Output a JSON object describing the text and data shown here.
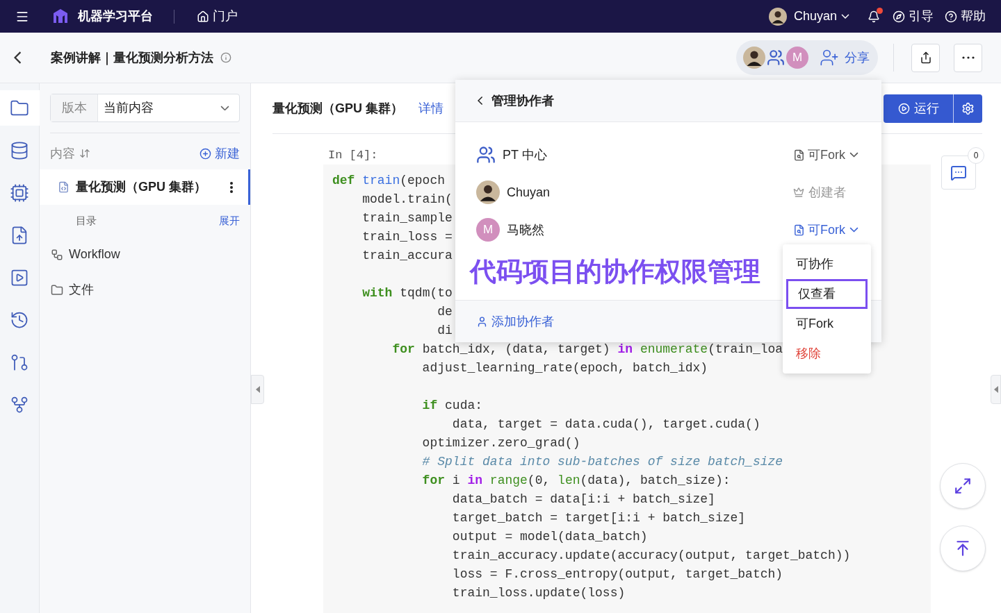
{
  "topbar": {
    "app_name": "机器学习平台",
    "portal_link": "门户",
    "user": "Chuyan",
    "has_notification": true,
    "guide": "引导",
    "help": "帮助"
  },
  "header": {
    "breadcrumb": "案例讲解｜量化预测分析方法",
    "share": "分享",
    "collaborators": [
      {
        "kind": "photo"
      },
      {
        "kind": "group"
      },
      {
        "kind": "letter",
        "letter": "M",
        "color": "#d18fbd"
      }
    ]
  },
  "rail": [
    {
      "kind": "folder",
      "selected": true
    },
    {
      "kind": "database",
      "selected": false
    },
    {
      "kind": "chip",
      "selected": false
    },
    {
      "kind": "file-cloud",
      "selected": false
    },
    {
      "kind": "file-play",
      "selected": false
    },
    {
      "kind": "history",
      "selected": false
    },
    {
      "kind": "pull-request",
      "selected": false
    },
    {
      "kind": "fork",
      "selected": false
    }
  ],
  "panel": {
    "version_label": "版本",
    "version_value": "当前内容",
    "content_label": "内容",
    "new_button": "新建",
    "files": [
      {
        "name": "量化预测（GPU 集群）",
        "selected": true
      }
    ],
    "toc_label": "目录",
    "expand": "展开",
    "items": [
      {
        "kind": "workflow",
        "label": "Workflow"
      },
      {
        "kind": "folder",
        "label": "文件"
      }
    ]
  },
  "notebook": {
    "title": "量化预测（GPU 集群）",
    "details_link": "详情",
    "run_button": "运行",
    "prompt": "In [4]:",
    "comment_count": "0",
    "code_blocks": [
      {
        "lines": [
          {
            "tokens": [
              {
                "kind": "keyword",
                "text": "def"
              },
              {
                "kind": "function",
                "text": " train"
              },
              {
                "kind": "plain",
                "text": "(epoch"
              }
            ]
          },
          {
            "tokens": [
              {
                "kind": "plain",
                "text": "    model.train("
              }
            ]
          },
          {
            "tokens": [
              {
                "kind": "plain",
                "text": "    train_sample"
              }
            ]
          },
          {
            "tokens": [
              {
                "kind": "plain",
                "text": "    train_loss ="
              }
            ]
          },
          {
            "tokens": [
              {
                "kind": "plain",
                "text": "    train_accura"
              }
            ]
          }
        ]
      },
      {
        "lines": [
          {
            "tokens": [
              {
                "kind": "keyword",
                "text": "    with"
              },
              {
                "kind": "plain",
                "text": " tqdm(to"
              }
            ]
          },
          {
            "tokens": [
              {
                "kind": "plain",
                "text": "              de"
              }
            ]
          },
          {
            "tokens": [
              {
                "kind": "plain",
                "text": "              di"
              }
            ]
          },
          {
            "tokens": [
              {
                "kind": "keyword",
                "text": "        for"
              },
              {
                "kind": "plain",
                "text": " batch_idx, (data, target) "
              },
              {
                "kind": "operator",
                "text": "in"
              },
              {
                "kind": "builtin",
                "text": " enumerate"
              },
              {
                "kind": "plain",
                "text": "(train_loa"
              }
            ]
          },
          {
            "tokens": [
              {
                "kind": "plain",
                "text": "            adjust_learning_rate(epoch, batch_idx)"
              }
            ]
          }
        ]
      },
      {
        "lines": [
          {
            "tokens": [
              {
                "kind": "keyword",
                "text": "            if"
              },
              {
                "kind": "plain",
                "text": " cuda:"
              }
            ]
          },
          {
            "tokens": [
              {
                "kind": "plain",
                "text": "                data, target = data.cuda(), target.cuda()"
              }
            ]
          },
          {
            "tokens": [
              {
                "kind": "plain",
                "text": "            optimizer.zero_grad()"
              }
            ]
          },
          {
            "tokens": [
              {
                "kind": "comment",
                "text": "            # Split data into sub-batches of size batch_size"
              }
            ]
          },
          {
            "tokens": [
              {
                "kind": "keyword",
                "text": "            for"
              },
              {
                "kind": "plain",
                "text": " i "
              },
              {
                "kind": "operator",
                "text": "in"
              },
              {
                "kind": "builtin",
                "text": " range"
              },
              {
                "kind": "plain",
                "text": "(0, "
              },
              {
                "kind": "builtin",
                "text": "len"
              },
              {
                "kind": "plain",
                "text": "(data), batch_size):"
              }
            ]
          },
          {
            "tokens": [
              {
                "kind": "plain",
                "text": "                data_batch = data[i:i + batch_size]"
              }
            ]
          },
          {
            "tokens": [
              {
                "kind": "plain",
                "text": "                target_batch = target[i:i + batch_size]"
              }
            ]
          },
          {
            "tokens": [
              {
                "kind": "plain",
                "text": "                output = model(data_batch)"
              }
            ]
          },
          {
            "tokens": [
              {
                "kind": "plain",
                "text": "                train_accuracy.update(accuracy(output, target_batch))"
              }
            ]
          },
          {
            "tokens": [
              {
                "kind": "plain",
                "text": "                loss = F.cross_entropy(output, target_batch)"
              }
            ]
          },
          {
            "tokens": [
              {
                "kind": "plain",
                "text": "                train_loss.update(loss)"
              }
            ]
          }
        ]
      }
    ]
  },
  "collab_popup": {
    "title": "管理协作者",
    "members": [
      {
        "kind": "group",
        "name": "PT 中心",
        "role": "可Fork",
        "editable": true,
        "open": false
      },
      {
        "kind": "photo",
        "name": "Chuyan",
        "role": "创建者",
        "editable": false
      },
      {
        "kind": "letter",
        "letter": "M",
        "color": "#d18fbd",
        "name": "马晓然",
        "role": "可Fork",
        "editable": true,
        "open": true
      }
    ],
    "add_button": "添加协作者",
    "menu": [
      {
        "label": "可协作",
        "selected": false,
        "danger": false
      },
      {
        "label": "仅查看",
        "selected": true,
        "danger": false
      },
      {
        "label": "可Fork",
        "selected": false,
        "danger": false
      },
      {
        "label": "移除",
        "selected": false,
        "danger": true
      }
    ]
  },
  "caption": "代码项目的协作权限管理"
}
